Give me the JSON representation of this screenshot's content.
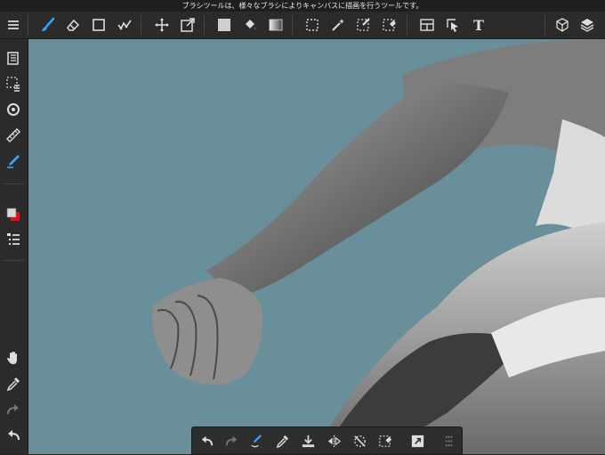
{
  "status_bar": {
    "tooltip": "ブラシツールは、様々なブラシによりキャンバスに描画を行うツールです。"
  },
  "colors": {
    "canvas_bg": "#698f9a",
    "toolbar_bg": "#2b2b2b",
    "accent": "#3aa0ff",
    "primary_swatch": "#d9d9d9",
    "secondary_swatch": "#e01010"
  },
  "toolbar": {
    "left_tools": [
      "menu-icon",
      "brush-icon",
      "eraser-icon",
      "shape-icon",
      "correction-icon"
    ],
    "transform_tools": [
      "move-icon",
      "transform-icon"
    ],
    "fill_tools": [
      "fill-color-icon",
      "bucket-icon",
      "gradient-icon"
    ],
    "selection_tools": [
      "select-rect-icon",
      "magic-wand-icon",
      "select-pen-icon",
      "select-eraser-icon"
    ],
    "extra_tools": [
      "frame-icon",
      "select-layer-icon",
      "text-icon"
    ],
    "right_tools": [
      "materials-icon",
      "layers-icon"
    ],
    "text_tool_label": "T"
  },
  "sidebar": {
    "top_items": [
      "pages-icon",
      "selection-menu-icon",
      "snap-icon",
      "ruler-icon",
      "pen-icon"
    ],
    "middle_items": [
      "color-swatch",
      "layer-list-icon"
    ],
    "bottom_items": [
      "hand-icon",
      "eyedropper-icon",
      "redo-icon",
      "undo-icon"
    ]
  },
  "bottom_bar": {
    "items": [
      "undo-icon",
      "redo-icon",
      "brush-swap-icon",
      "eyedropper-icon",
      "fill-layer-icon",
      "flip-icon",
      "deselect-icon",
      "select-clear-icon",
      "export-icon",
      "grip-icon"
    ]
  }
}
